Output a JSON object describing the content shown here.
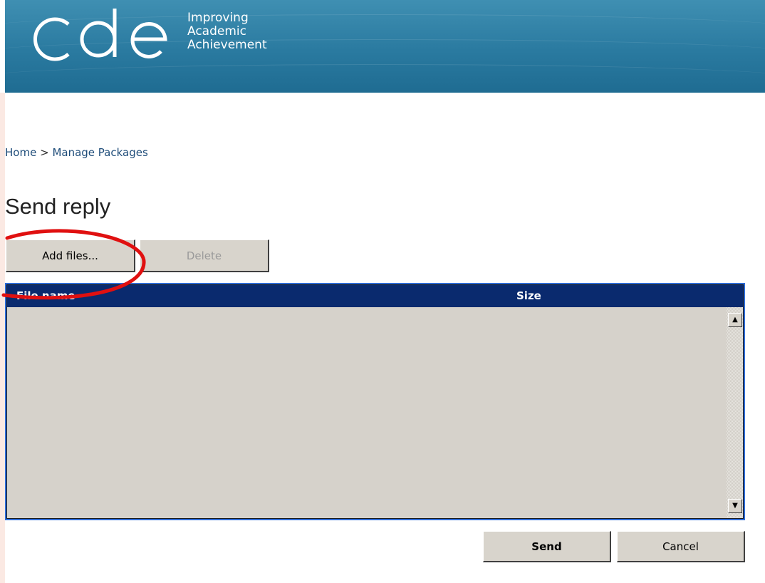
{
  "brand": {
    "logo_text": "cde",
    "tagline": [
      "Improving",
      "Academic",
      "Achievement"
    ]
  },
  "breadcrumb": {
    "home": "Home",
    "separator": ">",
    "current": "Manage Packages"
  },
  "page": {
    "title": "Send reply"
  },
  "toolbar": {
    "add_files_label": "Add files...",
    "delete_label": "Delete"
  },
  "file_table": {
    "columns": [
      "File name",
      "Size"
    ],
    "rows": []
  },
  "footer": {
    "send_label": "Send",
    "cancel_label": "Cancel"
  },
  "icons": {
    "scroll_up": "scroll-up-arrow-icon",
    "scroll_down": "scroll-down-arrow-icon"
  },
  "colors": {
    "banner": "#2a7aa0",
    "table_header": "#0a2a6e",
    "table_border": "#2d6bd8",
    "annotation": "#e01010"
  }
}
